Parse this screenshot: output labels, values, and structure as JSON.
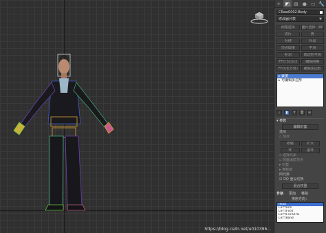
{
  "command_panel": {
    "tabs": [
      {
        "icon": "create-icon",
        "glyph": "+"
      },
      {
        "icon": "modify-icon",
        "glyph": "◩"
      },
      {
        "icon": "hierarchy-icon",
        "glyph": "▤"
      },
      {
        "icon": "motion-icon",
        "glyph": "●"
      },
      {
        "icon": "display-icon",
        "glyph": "▭"
      },
      {
        "icon": "utilities-icon",
        "glyph": "🔧"
      }
    ],
    "object_name": "CRaw0002-Body",
    "modifier_list": "修改器列表",
    "modifier_buttons": [
      [
        "网格选择",
        "面片选择（W）"
      ],
      [
        "切片",
        "壳"
      ],
      [
        "对称",
        "补洞"
      ],
      [
        "顶点焊接",
        "平滑"
      ],
      [
        "补洞",
        "四边形平滑"
      ],
      [
        "FFD 3x3x3",
        "编辑网格"
      ],
      [
        "FFD(长方体)",
        "编辑多边形"
      ]
    ],
    "stack_items": [
      {
        "label": "蒙皮",
        "selected": true
      },
      {
        "label": "可编辑多边形",
        "selected": false
      }
    ],
    "stack_icons": [
      {
        "icon": "pin-stack-icon",
        "glyph": "⊥",
        "active": false
      },
      {
        "icon": "show-end-result-icon",
        "glyph": "▮",
        "active": true
      },
      {
        "icon": "make-unique-icon",
        "glyph": "∀",
        "active": false
      },
      {
        "icon": "remove-modifier-icon",
        "glyph": "🗑",
        "active": false
      },
      {
        "icon": "configure-modifier-icon",
        "glyph": "⊞",
        "active": false
      }
    ],
    "params": {
      "title": "参数",
      "edit_envelope": "编辑封套",
      "select_title": "选择",
      "vertices_label": "顶点",
      "shrink": "收缩",
      "grow": "扩大",
      "ring": "环",
      "loop": "循环",
      "select_element": "选择元素",
      "backface_cull": "背面消隐顶点",
      "envelopes": "封套",
      "cross_sections": "横截面",
      "mirror_title": "四元数",
      "dq_toggle": "DQ 重设切换",
      "blend_weights": "混合权重",
      "bones_tab": "骨骼",
      "add_button": "添加",
      "remove_button": "移除",
      "sort_label": "排序方向：",
      "bones": [
        {
          "name": "Head",
          "selected": true
        },
        {
          "name": "LeftArm",
          "selected": false
        },
        {
          "name": "LeftFoot",
          "selected": false
        },
        {
          "name": "LeftForeArm",
          "selected": false
        },
        {
          "name": "LeftHand",
          "selected": false
        }
      ]
    }
  },
  "watermark": "https://blog.csdn.net/u010396..."
}
